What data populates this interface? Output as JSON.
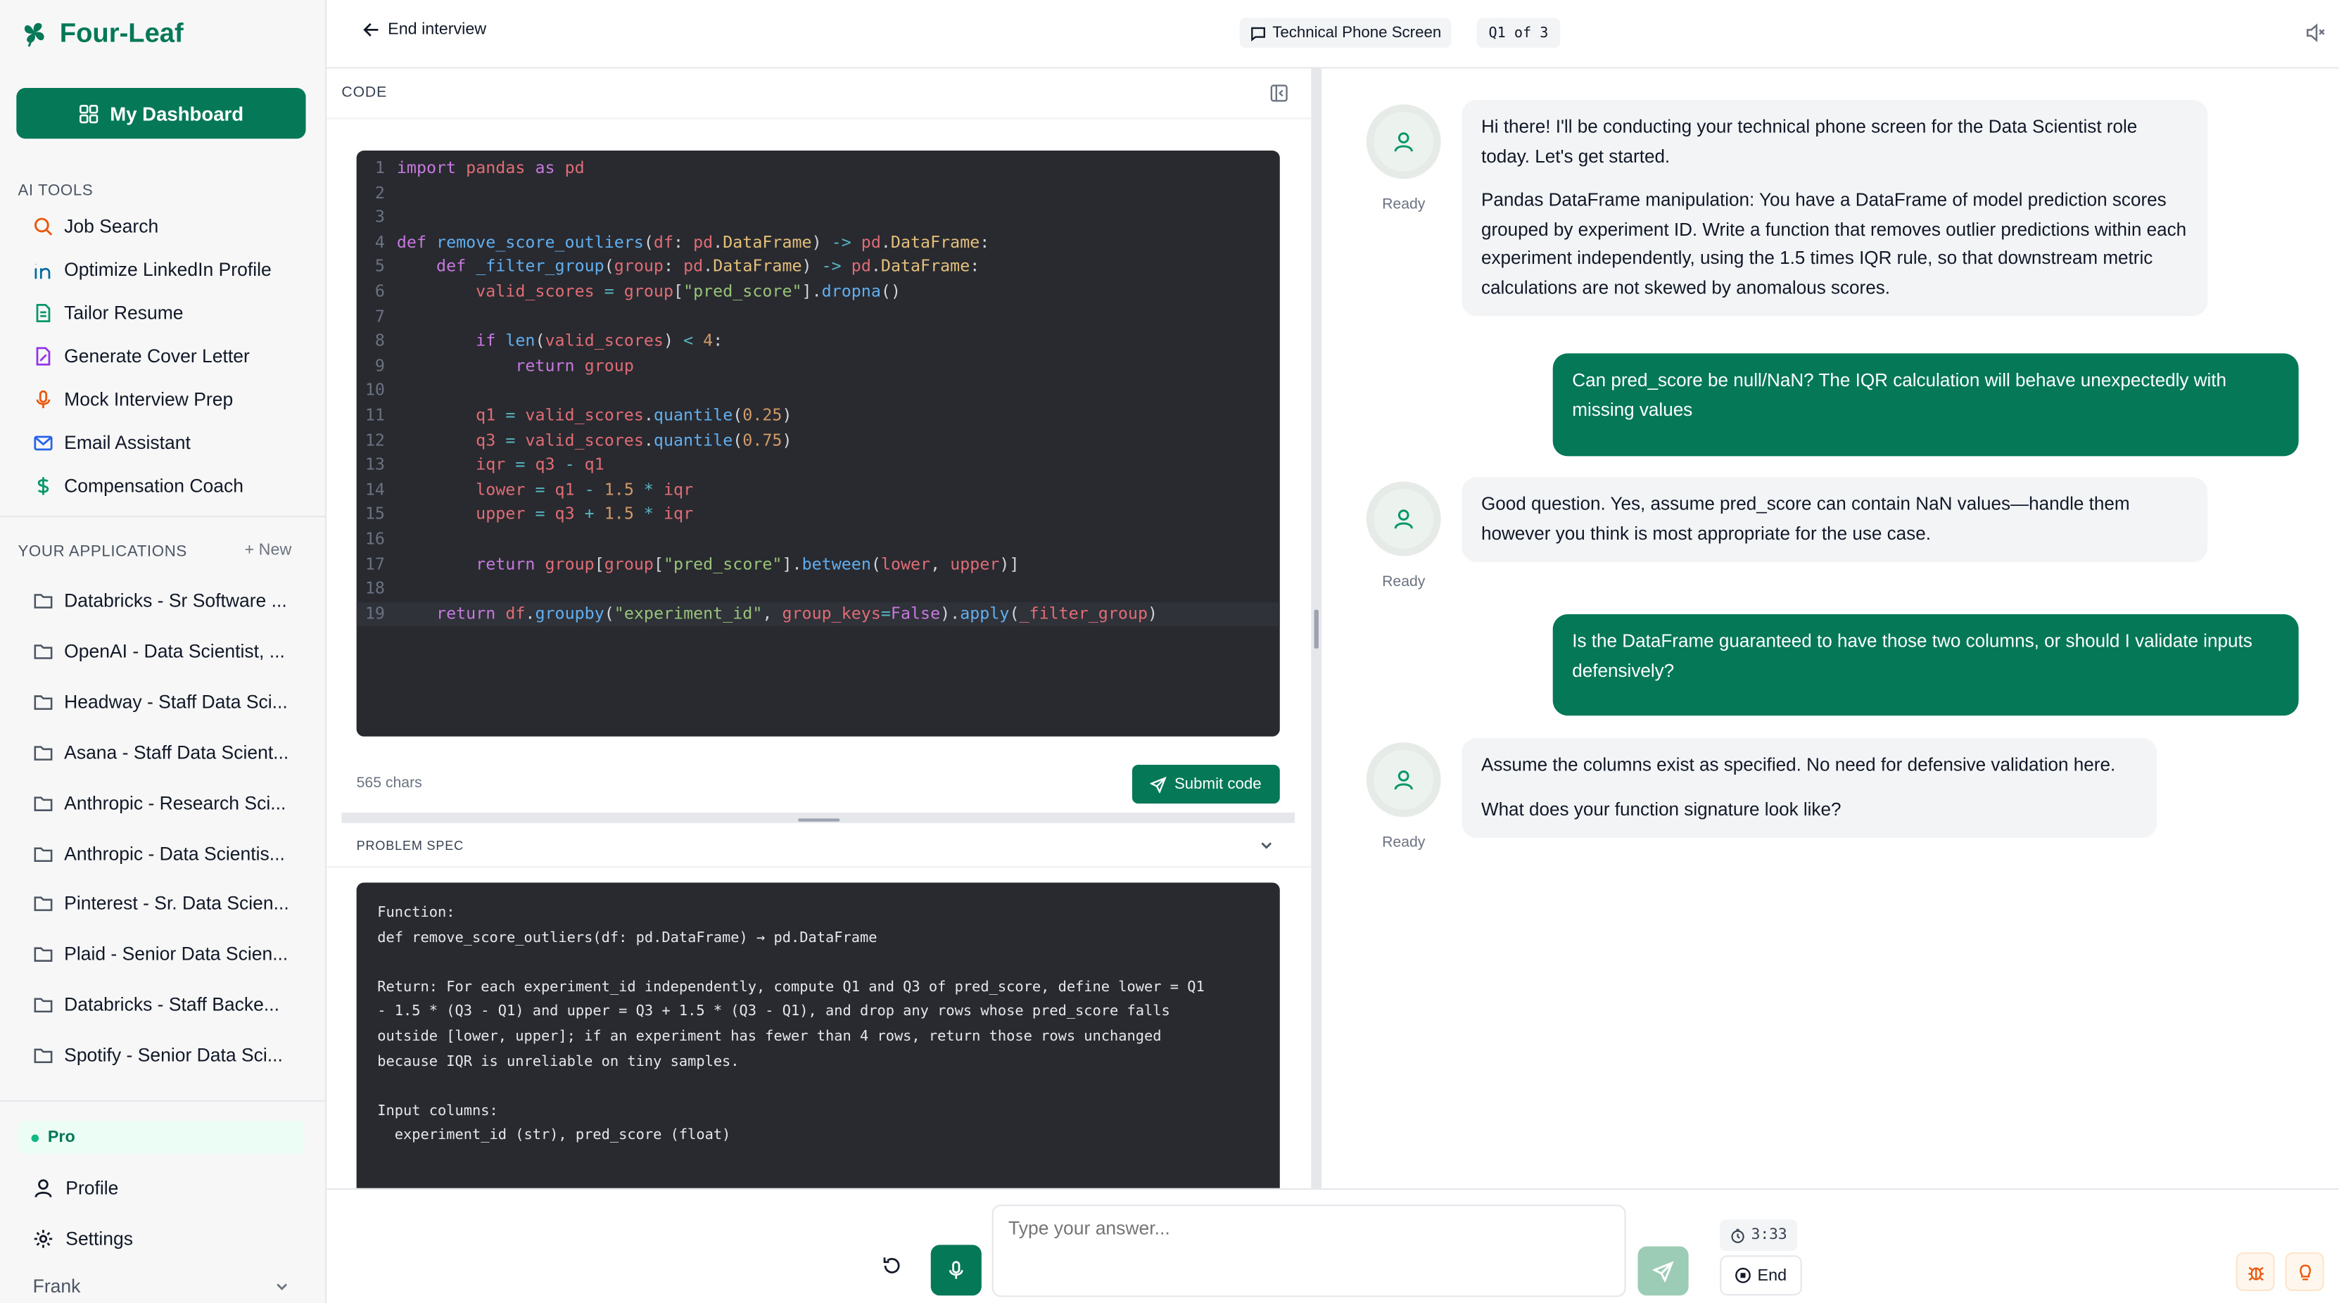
{
  "brand": {
    "name": "Four-Leaf",
    "color": "#047857"
  },
  "sidebar": {
    "dashboard_label": "My Dashboard",
    "ai_tools_label": "AI TOOLS",
    "tools": [
      {
        "label": "Job Search",
        "icon": "search-icon"
      },
      {
        "label": "Optimize LinkedIn Profile",
        "icon": "linkedin-icon"
      },
      {
        "label": "Tailor Resume",
        "icon": "document-icon"
      },
      {
        "label": "Generate Cover Letter",
        "icon": "pen-document-icon"
      },
      {
        "label": "Mock Interview Prep",
        "icon": "microphone-icon"
      },
      {
        "label": "Email Assistant",
        "icon": "mail-icon"
      },
      {
        "label": "Compensation Coach",
        "icon": "dollar-icon"
      }
    ],
    "applications_label": "YOUR APPLICATIONS",
    "new_label": "New",
    "applications": [
      "Databricks - Sr Software ...",
      "OpenAI - Data Scientist, ...",
      "Headway - Staff Data Sci...",
      "Asana - Staff Data Scient...",
      "Anthropic - Research Sci...",
      "Anthropic - Data Scientis...",
      "Pinterest - Sr. Data Scien...",
      "Plaid - Senior Data Scien...",
      "Databricks - Staff Backe...",
      "Spotify - Senior Data Sci..."
    ],
    "plan_label": "Pro",
    "profile_label": "Profile",
    "settings_label": "Settings",
    "user_name": "Frank"
  },
  "header": {
    "end_interview_label": "End interview",
    "interview_type": "Technical Phone Screen",
    "question_progress": "Q1 of 3"
  },
  "code_panel": {
    "label": "CODE",
    "lines": [
      "import pandas as pd",
      "",
      "",
      "def remove_score_outliers(df: pd.DataFrame) -> pd.DataFrame:",
      "    def _filter_group(group: pd.DataFrame) -> pd.DataFrame:",
      "        valid_scores = group[\"pred_score\"].dropna()",
      "",
      "        if len(valid_scores) < 4:",
      "            return group",
      "",
      "        q1 = valid_scores.quantile(0.25)",
      "        q3 = valid_scores.quantile(0.75)",
      "        iqr = q3 - q1",
      "        lower = q1 - 1.5 * iqr",
      "        upper = q3 + 1.5 * iqr",
      "",
      "        return group[group[\"pred_score\"].between(lower, upper)]",
      "",
      "    return df.groupby(\"experiment_id\", group_keys=False).apply(_filter_group)"
    ],
    "active_line": 19,
    "char_count": "565 chars",
    "submit_label": "Submit code"
  },
  "problem_spec": {
    "label": "PROBLEM SPEC",
    "lines": [
      "Function:",
      "def remove_score_outliers(df: pd.DataFrame) → pd.DataFrame",
      "",
      "Return: For each experiment_id independently, compute Q1 and Q3 of pred_score, define lower = Q1",
      "- 1.5 * (Q3 - Q1) and upper = Q3 + 1.5 * (Q3 - Q1), and drop any rows whose pred_score falls",
      "outside [lower, upper]; if an experiment has fewer than 4 rows, return those rows unchanged",
      "because IQR is unreliable on tiny samples.",
      "",
      "Input columns:",
      "  experiment_id (str), pred_score (float)"
    ]
  },
  "chat": {
    "status_label": "Ready",
    "messages": [
      {
        "role": "interviewer",
        "paragraphs": [
          "Hi there! I'll be conducting your technical phone screen for the Data Scientist role today. Let's get started.",
          "Pandas DataFrame manipulation: You have a DataFrame of model prediction scores grouped by experiment ID. Write a function that removes outlier predictions within each experiment independently, using the 1.5 times IQR rule, so that downstream metric calculations are not skewed by anomalous scores."
        ]
      },
      {
        "role": "candidate",
        "text": "Can pred_score be null/NaN? The IQR calculation will behave unexpectedly with missing values"
      },
      {
        "role": "interviewer",
        "paragraphs": [
          "Good question. Yes, assume pred_score can contain NaN values—handle them however you think is most appropriate for the use case."
        ]
      },
      {
        "role": "candidate",
        "text": "Is the DataFrame guaranteed to have those two columns, or should I validate inputs defensively?"
      },
      {
        "role": "interviewer",
        "paragraphs": [
          "Assume the columns exist as specified. No need for defensive validation here.",
          "What does your function signature look like?"
        ]
      }
    ]
  },
  "composer": {
    "placeholder": "Type your answer...",
    "timer": "3:33",
    "end_label": "End"
  }
}
